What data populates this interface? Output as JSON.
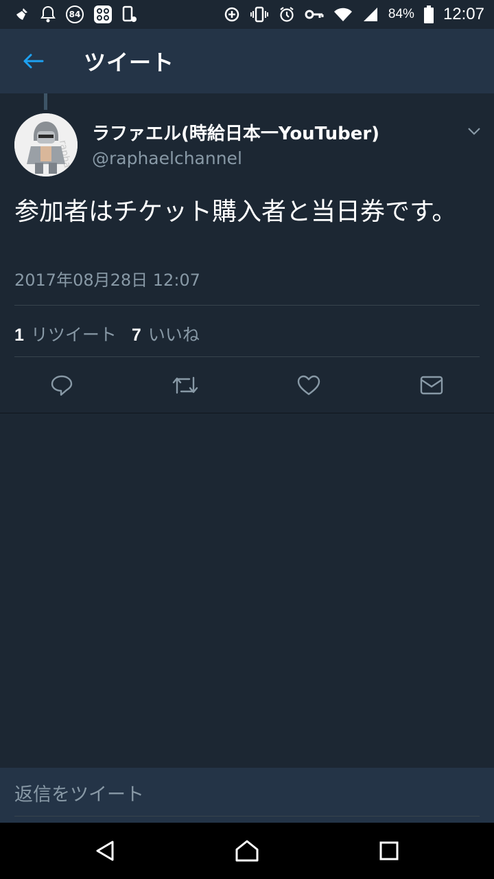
{
  "status_bar": {
    "notification_badge": "84",
    "battery_percent": "84%",
    "time": "12:07"
  },
  "header": {
    "title": "ツイート"
  },
  "tweet": {
    "author_name": "ラファエル(時給日本一YouTuber)",
    "author_handle": "@raphaelchannel",
    "text": "参加者はチケット購入者と当日券です。",
    "timestamp": "2017年08月28日 12:07",
    "retweet_count": "1",
    "retweet_label": "リツイート",
    "like_count": "7",
    "like_label": "いいね"
  },
  "reply": {
    "placeholder": "返信をツイート"
  },
  "colors": {
    "background": "#1c2733",
    "app_bar": "#243447",
    "accent": "#1da1f2",
    "secondary_text": "#8899a6"
  }
}
